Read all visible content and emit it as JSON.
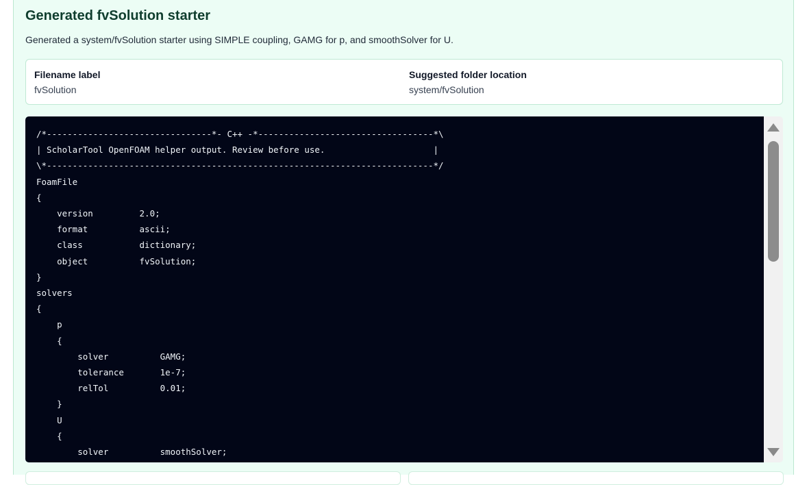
{
  "panel": {
    "title": "Generated fvSolution starter",
    "description": "Generated a system/fvSolution starter using SIMPLE coupling, GAMG for p, and smoothSolver for U."
  },
  "info": {
    "filename_label": "Filename label",
    "filename_value": "fvSolution",
    "folder_label": "Suggested folder location",
    "folder_value": "system/fvSolution"
  },
  "code": {
    "content": "/*--------------------------------*- C++ -*----------------------------------*\\\n| ScholarTool OpenFOAM helper output. Review before use.                     |\n\\*---------------------------------------------------------------------------*/\nFoamFile\n{\n    version         2.0;\n    format          ascii;\n    class           dictionary;\n    object          fvSolution;\n}\nsolvers\n{\n    p\n    {\n        solver          GAMG;\n        tolerance       1e-7;\n        relTol          0.01;\n    }\n    U\n    {\n        solver          smoothSolver;"
  }
}
